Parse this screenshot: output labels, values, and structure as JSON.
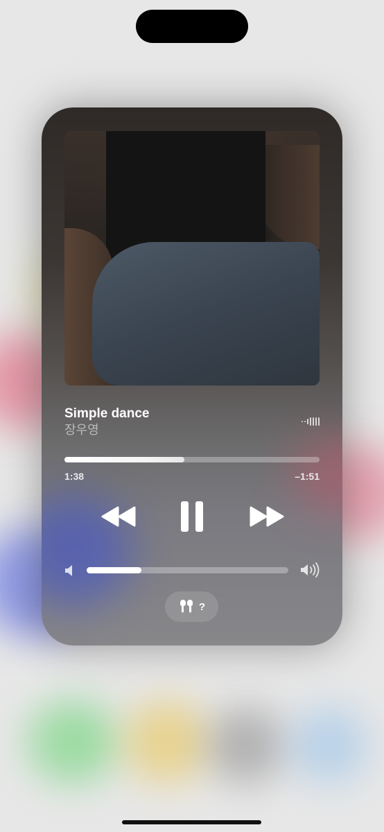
{
  "now_playing": {
    "title": "Simple dance",
    "artist": "장우영",
    "elapsed": "1:38",
    "remaining": "–1:51",
    "progress": 0.47,
    "volume": 0.27,
    "playback_state": "playing",
    "output_device_label": "?",
    "output_device_icon": "airpods-icon"
  },
  "controls": {
    "rewind_icon": "rewind-icon",
    "pause_icon": "pause-icon",
    "forward_icon": "fast-forward-icon",
    "volume_low_icon": "speaker-low-icon",
    "volume_high_icon": "speaker-high-icon",
    "waveform_icon": "waveform-icon"
  },
  "colors": {
    "accent": "#ffffff",
    "track": "rgba(255,255,255,0.3)"
  }
}
